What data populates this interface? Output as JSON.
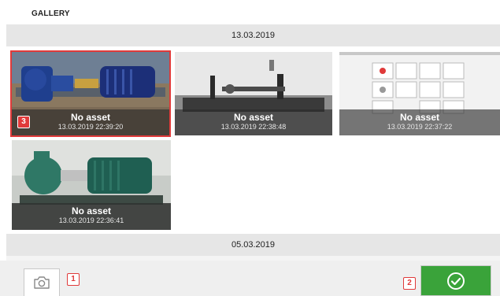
{
  "header": {
    "title": "GALLERY"
  },
  "groups": [
    {
      "date": "13.03.2019",
      "items": [
        {
          "asset": "No asset",
          "timestamp": "13.03.2019 22:39:20",
          "selected": true,
          "scene": "blue-pump"
        },
        {
          "asset": "No asset",
          "timestamp": "13.03.2019 22:38:48",
          "selected": false,
          "scene": "workbench"
        },
        {
          "asset": "No asset",
          "timestamp": "13.03.2019 22:37:22",
          "selected": false,
          "scene": "device-screen"
        },
        {
          "asset": "No asset",
          "timestamp": "13.03.2019 22:36:41",
          "selected": false,
          "scene": "green-pump"
        }
      ]
    },
    {
      "date": "05.03.2019",
      "items": []
    }
  ],
  "callouts": {
    "camera": "1",
    "confirm": "2",
    "selected": "3"
  },
  "icons": {
    "camera": "camera-icon",
    "confirm": "checkmark-circle-icon"
  },
  "colors": {
    "accent_green": "#3aa33a",
    "callout_red": "#e03a3a",
    "date_bar": "#e6e6e6"
  }
}
